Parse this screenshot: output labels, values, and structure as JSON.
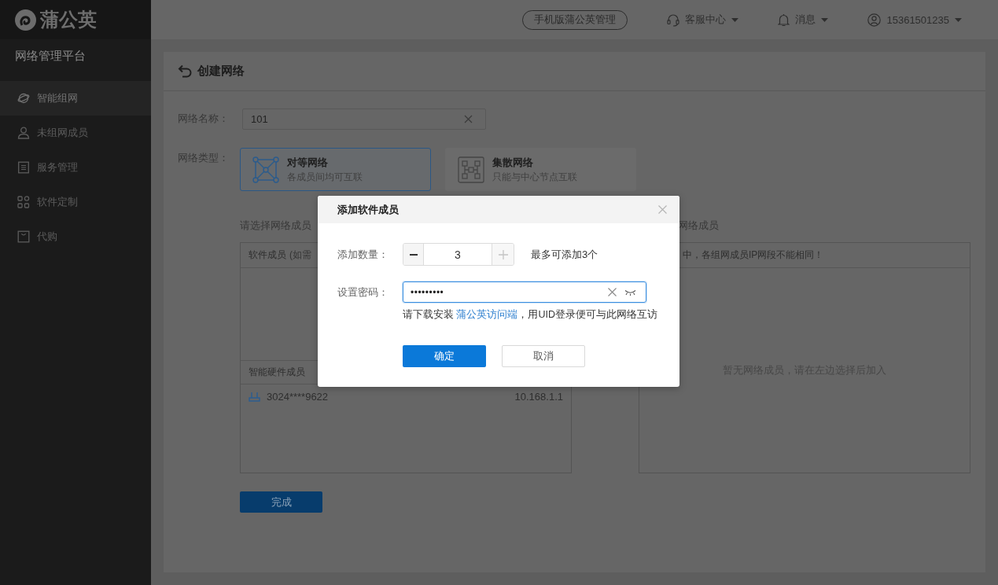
{
  "sidebar": {
    "logo": "蒲公英",
    "title": "网络管理平台",
    "items": [
      {
        "label": "智能组网",
        "selected": true
      },
      {
        "label": "未组网成员",
        "selected": false
      },
      {
        "label": "服务管理",
        "selected": false
      },
      {
        "label": "软件定制",
        "selected": false
      },
      {
        "label": "代购",
        "selected": false
      }
    ]
  },
  "top_bar": {
    "mobile_button": "手机版蒲公英管理",
    "menus": [
      {
        "label": "客服中心"
      },
      {
        "label": "消息"
      },
      {
        "label": "15361501235"
      }
    ]
  },
  "page": {
    "title": "创建网络",
    "name_label": "网络名称：",
    "name_value": "101",
    "type_label": "网络类型：",
    "types": [
      {
        "title": "对等网络",
        "subtitle": "各成员间均可互联",
        "selected": true
      },
      {
        "title": "集散网络",
        "subtitle": "只能与中心节点互联",
        "selected": false
      }
    ],
    "members_label": "请选择网络成员",
    "selected_label": "网络成员",
    "software_header": "软件成员",
    "software_note": "(如需",
    "hardware_header": "智能硬件成员",
    "devices": [
      {
        "id": "3024****9622",
        "ip": "10.168.1.1"
      }
    ],
    "notice": "中，各组网成员IP网段不能相同！",
    "empty_message": "暂无网络成员，请在左边选择后加入",
    "done_button": "完成"
  },
  "dialog": {
    "title": "添加软件成员",
    "quantity_label": "添加数量：",
    "stepper": {
      "value": "3",
      "decrement_disabled": false,
      "increment_disabled": true
    },
    "quantity_hint": "最多可添加3个",
    "password_label": "设置密码：",
    "password_field": {
      "value": "•••••••••",
      "focused": true
    },
    "help_before": "请下载安装 ",
    "help_link": "蒲公英访问端",
    "help_after": "，用UID登录便可与此网络互访",
    "confirm_button": "确定",
    "cancel_button": "取消"
  }
}
